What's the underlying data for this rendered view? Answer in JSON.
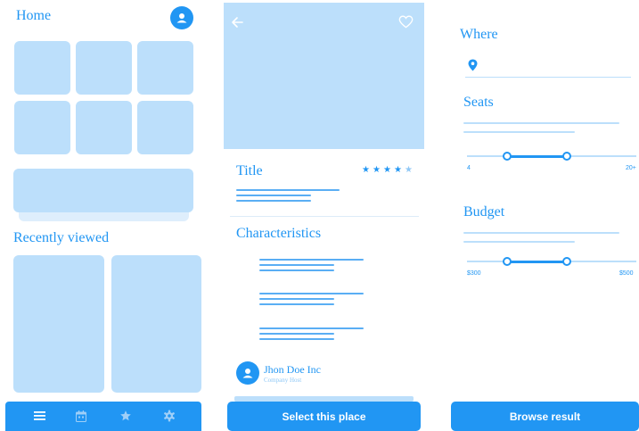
{
  "colors": {
    "accent": "#2196f3",
    "placeholder": "#bcdffb",
    "star_empty": "#90c8f6"
  },
  "home": {
    "title": "Home",
    "recently_viewed_label": "Recently viewed",
    "nav_icons": [
      "menu-icon",
      "calendar-icon",
      "star-icon",
      "gear-icon"
    ]
  },
  "detail": {
    "title": "Title",
    "rating": {
      "value": 4,
      "max": 5
    },
    "characteristics_label": "Characteristics",
    "host_name": "Jhon Doe Inc",
    "host_role": "Company Host",
    "select_button": "Select this place"
  },
  "search": {
    "where_label": "Where",
    "seats_label": "Seats",
    "seats_min": "4",
    "seats_max": "20+",
    "budget_label": "Budget",
    "budget_min": "$300",
    "budget_max": "$500",
    "browse_button": "Browse result"
  }
}
